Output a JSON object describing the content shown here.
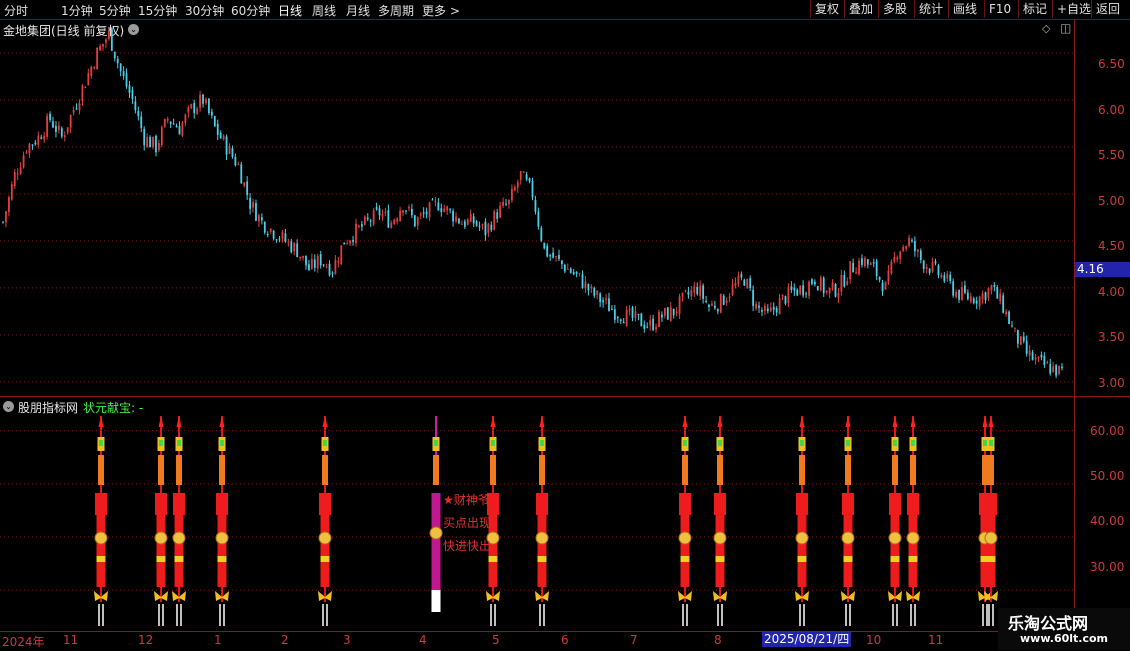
{
  "toolbar": {
    "periods": [
      "分时",
      "1分钟",
      "5分钟",
      "15分钟",
      "30分钟",
      "60分钟",
      "日线",
      "周线",
      "月线",
      "多周期",
      "更多 >"
    ],
    "active_period": "日线",
    "tools": [
      "复权",
      "叠加",
      "多股",
      "统计",
      "画线",
      "F10",
      "标记",
      "+自选",
      "返回"
    ]
  },
  "chart_title": "金地集团(日线 前复权)",
  "price_axis": [
    "6.50",
    "6.00",
    "5.50",
    "5.00",
    "4.50",
    "4.00",
    "3.50",
    "3.00"
  ],
  "current_price": "4.16",
  "indicator": {
    "name": "股朋指标网",
    "param": "状元献宝: -",
    "axis": [
      "60.00",
      "50.00",
      "40.00",
      "30.00"
    ],
    "signals": [
      "★财神爷",
      "买点出现",
      "快进快出"
    ]
  },
  "date_axis": {
    "year": "2024年",
    "months": [
      "11",
      "12",
      "1",
      "2",
      "3",
      "4",
      "5",
      "6",
      "7",
      "8",
      "10",
      "11"
    ],
    "cursor_date": "2025/08/21/四"
  },
  "watermark": {
    "line1": "乐淘公式网",
    "line2": "www.60lt.com"
  },
  "colors": {
    "up": "#e04040",
    "down": "#4ad0e8",
    "grid": "#8a1818",
    "accent": "#2224aa"
  },
  "chart_data": {
    "type": "candlestick",
    "title": "金地集团(日线 前复权)",
    "ylim": [
      2.85,
      6.85
    ],
    "close": [
      4.7,
      5.2,
      5.5,
      5.6,
      5.8,
      5.6,
      5.9,
      6.2,
      6.5,
      6.7,
      6.3,
      6.0,
      5.6,
      5.5,
      5.8,
      5.7,
      5.9,
      6.0,
      5.7,
      5.5,
      5.3,
      4.9,
      4.7,
      4.6,
      4.5,
      4.4,
      4.2,
      4.3,
      4.2,
      4.5,
      4.6,
      4.7,
      4.8,
      4.7,
      4.9,
      4.7,
      4.8,
      4.9,
      4.8,
      4.7,
      4.7,
      4.6,
      4.8,
      4.9,
      5.2,
      5.0,
      4.4,
      4.3,
      4.2,
      4.1,
      3.95,
      3.85,
      3.75,
      3.7,
      3.65,
      3.6,
      3.7,
      3.75,
      3.9,
      4.0,
      3.8,
      3.85,
      4.0,
      4.1,
      3.8,
      3.7,
      3.85,
      3.95,
      4.0,
      4.1,
      3.95,
      4.0,
      4.2,
      4.3,
      4.2,
      4.0,
      4.4,
      4.5,
      4.3,
      4.2,
      4.1,
      3.95,
      3.9,
      3.9,
      4.0,
      3.8,
      3.5,
      3.3,
      3.2,
      3.15,
      3.1
    ]
  }
}
